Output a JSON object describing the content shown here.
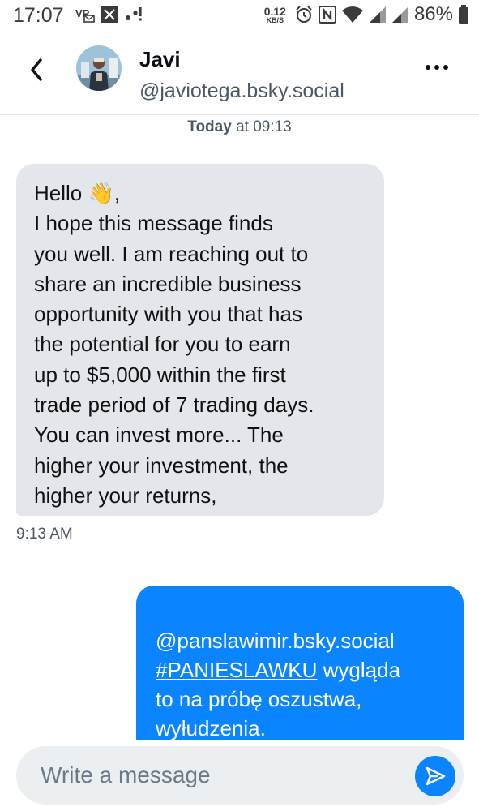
{
  "status_bar": {
    "time": "17:07",
    "net_speed_value": "0.12",
    "net_speed_unit": "KB/S",
    "battery": "86%",
    "icons": [
      "vpn-icon",
      "notification-icon",
      "walk-icon",
      "alarm-icon",
      "nfc-icon",
      "wifi-icon",
      "signal-icon",
      "signal-icon",
      "battery-icon"
    ]
  },
  "header": {
    "name": "Javi",
    "handle": "@javiotega.bsky.social"
  },
  "chat": {
    "date_bold": "Today",
    "date_rest": " at 09:13",
    "incoming": {
      "text": "Hello 👋,\nI hope this message finds\nyou well. I am reaching out to\nshare an incredible business\nopportunity with you that has\nthe potential for you to earn\nup to $5,000 within the first\ntrade period of 7 trading days.\nYou can invest more... The\nhigher your investment, the\nhigher your returns,",
      "time": "9:13 AM"
    },
    "outgoing": {
      "mention": "@panslawimir.bsky.social",
      "hashtag": "#PANIESLAWKU",
      "text": " wygląda\nto na próbę oszustwa,\nwyłudzenia."
    }
  },
  "composer": {
    "placeholder": "Write a message"
  },
  "colors": {
    "accent": "#0b84ff",
    "incoming_bubble": "#e3e6ea",
    "muted_text": "#4b5866"
  }
}
